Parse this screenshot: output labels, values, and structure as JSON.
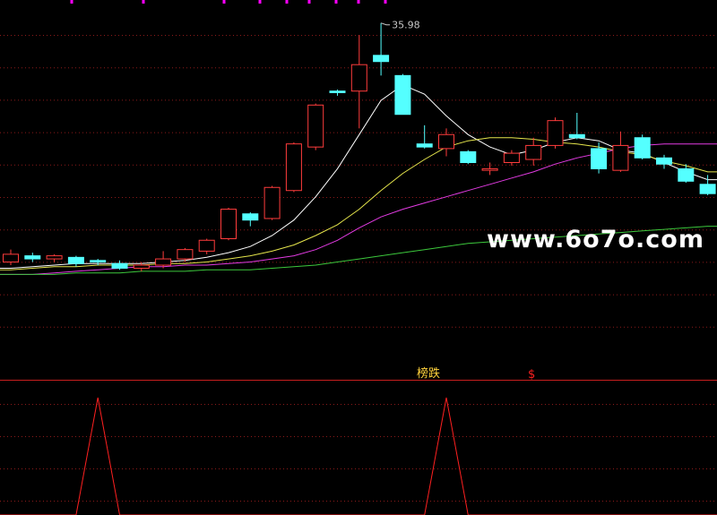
{
  "watermark": "www.6o7o.com",
  "annotations": {
    "signal_label": "榜跌",
    "signal_mark": "$"
  },
  "colors": {
    "background": "#000000",
    "grid": "#8c1a1a",
    "candle_up": "#ff3c3c",
    "candle_down": "#54ffff",
    "ma_white": "#ffffff",
    "ma_yellow": "#e6e64c",
    "ma_magenta": "#e33be3",
    "ma_green": "#3cc83c",
    "signal_line": "#ff2020",
    "label_yellow": "#ffd23c",
    "separator": "#c81e1e"
  },
  "chart_data": [
    {
      "type": "candlestick",
      "max_label": "35.98",
      "max_candle_index": 17,
      "ylim": [
        17.0,
        37.0
      ],
      "grid": true,
      "candles": [
        {
          "o": 20.6,
          "h": 21.4,
          "l": 20.4,
          "c": 21.1
        },
        {
          "o": 21.0,
          "h": 21.2,
          "l": 20.6,
          "c": 20.8
        },
        {
          "o": 20.8,
          "h": 21.1,
          "l": 20.6,
          "c": 21.0
        },
        {
          "o": 20.9,
          "h": 21.0,
          "l": 20.3,
          "c": 20.5
        },
        {
          "o": 20.7,
          "h": 20.8,
          "l": 20.4,
          "c": 20.6
        },
        {
          "o": 20.5,
          "h": 20.7,
          "l": 20.1,
          "c": 20.2
        },
        {
          "o": 20.2,
          "h": 20.6,
          "l": 20.0,
          "c": 20.4
        },
        {
          "o": 20.4,
          "h": 21.3,
          "l": 20.2,
          "c": 20.8
        },
        {
          "o": 20.8,
          "h": 21.5,
          "l": 20.6,
          "c": 21.4
        },
        {
          "o": 21.3,
          "h": 22.1,
          "l": 21.1,
          "c": 22.0
        },
        {
          "o": 22.1,
          "h": 24.1,
          "l": 22.0,
          "c": 24.0
        },
        {
          "o": 23.7,
          "h": 23.8,
          "l": 22.9,
          "c": 23.3
        },
        {
          "o": 23.4,
          "h": 25.5,
          "l": 23.3,
          "c": 25.4
        },
        {
          "o": 25.2,
          "h": 28.3,
          "l": 25.1,
          "c": 28.2
        },
        {
          "o": 28.0,
          "h": 30.8,
          "l": 27.8,
          "c": 30.7
        },
        {
          "o": 31.6,
          "h": 31.7,
          "l": 31.3,
          "c": 31.5
        },
        {
          "o": 31.6,
          "h": 35.2,
          "l": 29.2,
          "c": 33.3
        },
        {
          "o": 33.9,
          "h": 35.98,
          "l": 32.6,
          "c": 33.5
        },
        {
          "o": 32.6,
          "h": 32.7,
          "l": 30.1,
          "c": 30.1
        },
        {
          "o": 28.2,
          "h": 29.4,
          "l": 27.9,
          "c": 28.0
        },
        {
          "o": 27.9,
          "h": 29.2,
          "l": 27.4,
          "c": 28.8
        },
        {
          "o": 27.7,
          "h": 27.8,
          "l": 26.9,
          "c": 27.0
        },
        {
          "o": 26.5,
          "h": 27.0,
          "l": 26.2,
          "c": 26.6
        },
        {
          "o": 27.0,
          "h": 27.8,
          "l": 26.8,
          "c": 27.6
        },
        {
          "o": 27.2,
          "h": 28.6,
          "l": 26.8,
          "c": 28.1
        },
        {
          "o": 28.1,
          "h": 29.9,
          "l": 27.9,
          "c": 29.7
        },
        {
          "o": 28.8,
          "h": 30.2,
          "l": 28.5,
          "c": 28.6
        },
        {
          "o": 27.9,
          "h": 28.3,
          "l": 26.3,
          "c": 26.6
        },
        {
          "o": 26.5,
          "h": 29.0,
          "l": 26.4,
          "c": 28.1
        },
        {
          "o": 28.6,
          "h": 28.8,
          "l": 27.2,
          "c": 27.3
        },
        {
          "o": 27.3,
          "h": 27.5,
          "l": 26.6,
          "c": 26.9
        },
        {
          "o": 26.6,
          "h": 26.9,
          "l": 25.7,
          "c": 25.8
        },
        {
          "o": 25.6,
          "h": 26.2,
          "l": 24.9,
          "c": 25.0
        }
      ],
      "moving_averages": [
        {
          "color_key": "ma_white",
          "values": [
            20.2,
            20.3,
            20.4,
            20.5,
            20.5,
            20.5,
            20.5,
            20.6,
            20.7,
            20.9,
            21.2,
            21.6,
            22.3,
            23.3,
            24.8,
            26.6,
            28.8,
            31.0,
            32.0,
            31.4,
            30.0,
            28.8,
            28.0,
            27.5,
            27.8,
            28.3,
            28.6,
            28.4,
            27.8,
            27.6,
            27.0,
            26.4,
            25.9
          ]
        },
        {
          "color_key": "ma_yellow",
          "values": [
            20.1,
            20.2,
            20.3,
            20.3,
            20.4,
            20.4,
            20.4,
            20.5,
            20.5,
            20.6,
            20.8,
            21.0,
            21.3,
            21.7,
            22.3,
            23.0,
            24.0,
            25.2,
            26.3,
            27.2,
            28.0,
            28.4,
            28.6,
            28.6,
            28.5,
            28.3,
            28.2,
            28.0,
            27.7,
            27.5,
            27.1,
            26.8,
            26.4
          ]
        },
        {
          "color_key": "ma_magenta",
          "values": [
            19.8,
            19.8,
            19.9,
            20.0,
            20.1,
            20.2,
            20.3,
            20.3,
            20.4,
            20.4,
            20.5,
            20.6,
            20.8,
            21.0,
            21.4,
            22.0,
            22.8,
            23.5,
            24.0,
            24.4,
            24.8,
            25.2,
            25.6,
            26.0,
            26.4,
            26.9,
            27.3,
            27.6,
            27.9,
            28.1,
            28.2,
            28.2,
            28.2
          ]
        },
        {
          "color_key": "ma_green",
          "values": [
            19.8,
            19.8,
            19.8,
            19.9,
            19.9,
            19.9,
            20.0,
            20.0,
            20.0,
            20.1,
            20.1,
            20.1,
            20.2,
            20.3,
            20.4,
            20.6,
            20.8,
            21.0,
            21.2,
            21.4,
            21.6,
            21.8,
            21.9,
            22.0,
            22.1,
            22.2,
            22.3,
            22.4,
            22.5,
            22.6,
            22.7,
            22.8,
            22.9
          ]
        }
      ]
    },
    {
      "type": "line",
      "x": [
        0,
        3,
        4,
        5,
        8,
        19,
        20,
        21,
        32
      ],
      "values": [
        0,
        0,
        1,
        0,
        0,
        0,
        1,
        0,
        0
      ],
      "ylim": [
        0,
        1
      ]
    }
  ]
}
